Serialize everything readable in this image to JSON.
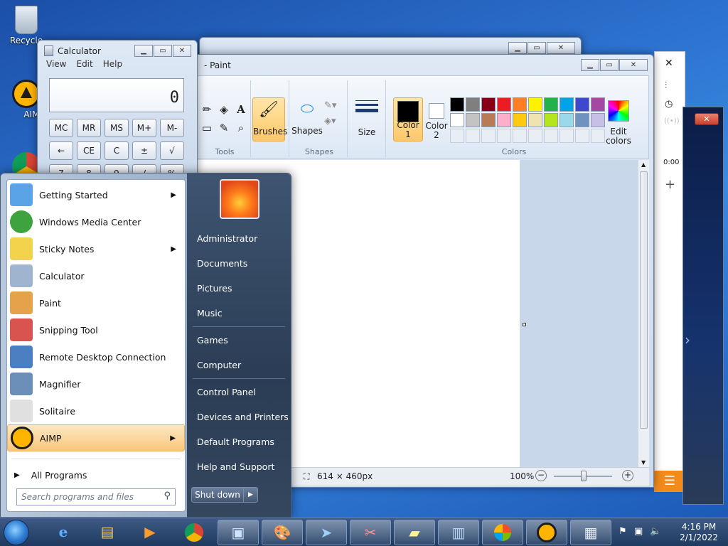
{
  "desktop": {
    "icons": [
      {
        "label": "Recycle",
        "icon": "recycle-bin-icon"
      },
      {
        "label": "AIMP",
        "icon": "aimp-icon"
      },
      {
        "label": "",
        "icon": "chrome-icon"
      }
    ]
  },
  "calculator": {
    "title": "Calculator",
    "menu": [
      "View",
      "Edit",
      "Help"
    ],
    "display": "0",
    "row1": [
      "MC",
      "MR",
      "MS",
      "M+",
      "M-"
    ],
    "row2": [
      "←",
      "CE",
      "C",
      "±",
      "√"
    ],
    "row3": [
      "7",
      "8",
      "9",
      "/",
      "%"
    ]
  },
  "paint": {
    "title": "- Paint",
    "ribbon": {
      "tools_label": "Tools",
      "brushes_label": "Brushes",
      "shapes_label": "Shapes",
      "shapes_group_label": "Shapes",
      "size_label": "Size",
      "color1_label": "Color 1",
      "color2_label": "Color 2",
      "colors_group_label": "Colors",
      "edit_colors_label": "Edit colors"
    },
    "palette": [
      "#000000",
      "#7f7f7f",
      "#880015",
      "#ed1c24",
      "#ff7f27",
      "#fff200",
      "#22b14c",
      "#00a2e8",
      "#3f48cc",
      "#a349a4",
      "#ffffff",
      "#c3c3c3",
      "#b97a57",
      "#ffaec9",
      "#ffc90e",
      "#efe4b0",
      "#b5e61d",
      "#99d9ea",
      "#7092be",
      "#c8bfe7"
    ],
    "color1": "#000000",
    "color2": "#ffffff",
    "status_size": "614 × 460px",
    "zoom": "100%"
  },
  "aimp_panel": {
    "time": "0:00"
  },
  "start_menu": {
    "programs": [
      {
        "label": "Getting Started",
        "icon": "getting-started-icon",
        "arrow": true
      },
      {
        "label": "Windows Media Center",
        "icon": "media-center-icon",
        "arrow": false
      },
      {
        "label": "Sticky Notes",
        "icon": "sticky-notes-icon",
        "arrow": true
      },
      {
        "label": "Calculator",
        "icon": "calculator-icon",
        "arrow": false
      },
      {
        "label": "Paint",
        "icon": "paint-icon",
        "arrow": false
      },
      {
        "label": "Snipping Tool",
        "icon": "snipping-tool-icon",
        "arrow": false
      },
      {
        "label": "Remote Desktop Connection",
        "icon": "remote-desktop-icon",
        "arrow": false
      },
      {
        "label": "Magnifier",
        "icon": "magnifier-icon",
        "arrow": false
      },
      {
        "label": "Solitaire",
        "icon": "solitaire-icon",
        "arrow": false
      },
      {
        "label": "AIMP",
        "icon": "aimp-icon",
        "arrow": true
      }
    ],
    "all_programs": "All Programs",
    "search_placeholder": "Search programs and files",
    "right_links": [
      "Administrator",
      "Documents",
      "Pictures",
      "Music",
      "Games",
      "Computer",
      "Control Panel",
      "Devices and Printers",
      "Default Programs",
      "Help and Support"
    ],
    "shutdown_label": "Shut down"
  },
  "taskbar": {
    "time": "4:16 PM",
    "date": "2/1/2022"
  }
}
